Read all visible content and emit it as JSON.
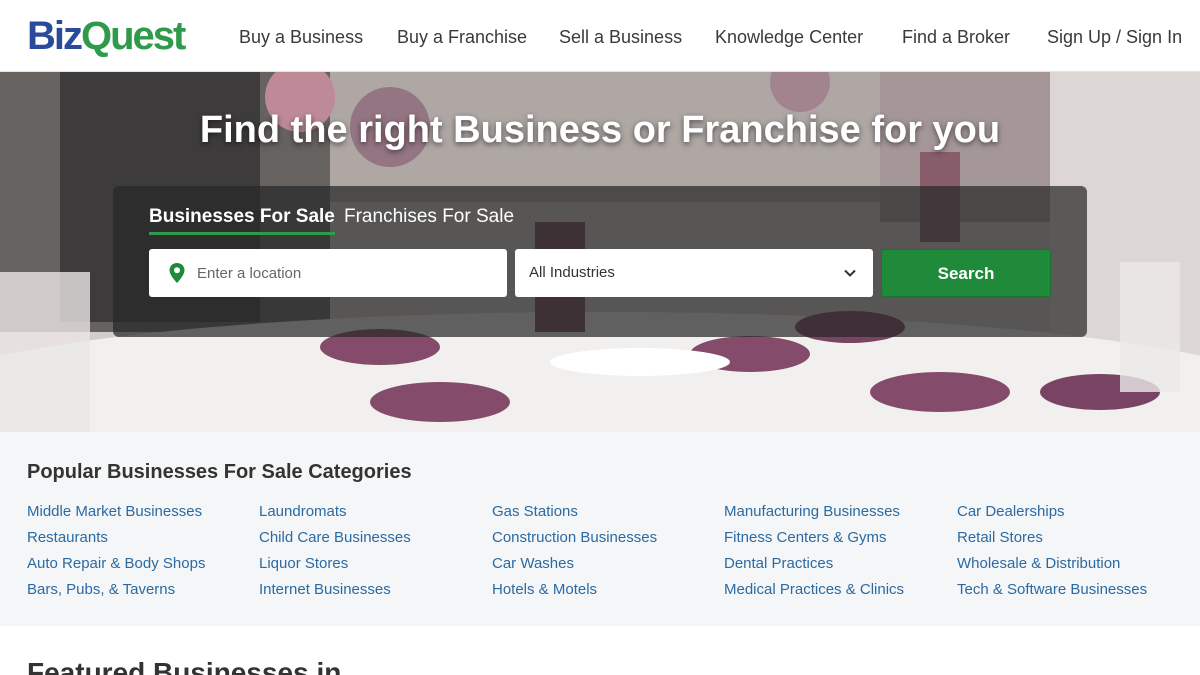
{
  "header": {
    "logo": {
      "part1": "Biz",
      "part2": "Quest"
    },
    "nav": [
      {
        "label": "Buy a Business"
      },
      {
        "label": "Buy a Franchise"
      },
      {
        "label": "Sell a Business"
      },
      {
        "label": "Knowledge Center"
      },
      {
        "label": "Find a Broker"
      },
      {
        "label": "Sign Up / Sign In"
      }
    ]
  },
  "hero": {
    "title": "Find the right Business or Franchise for you",
    "tabs": [
      {
        "label": "Businesses For Sale",
        "active": true
      },
      {
        "label": "Franchises For Sale",
        "active": false
      }
    ],
    "location_placeholder": "Enter a location",
    "industry_selected": "All Industries",
    "search_label": "Search"
  },
  "categories": {
    "title": "Popular Businesses For Sale Categories",
    "columns": [
      [
        "Middle Market Businesses",
        "Restaurants",
        "Auto Repair & Body Shops",
        "Bars, Pubs, & Taverns"
      ],
      [
        "Laundromats",
        "Child Care Businesses",
        "Liquor Stores",
        "Internet Businesses"
      ],
      [
        "Gas Stations",
        "Construction Businesses",
        "Car Washes",
        "Hotels & Motels"
      ],
      [
        "Manufacturing Businesses",
        "Fitness Centers & Gyms",
        "Dental Practices",
        "Medical Practices & Clinics"
      ],
      [
        "Car Dealerships",
        "Retail Stores",
        "Wholesale & Distribution",
        "Tech & Software Businesses"
      ]
    ]
  },
  "featured_title": "Featured Businesses in",
  "colors": {
    "brand_blue": "#2a4a9c",
    "brand_green": "#2f9a4a",
    "button_green": "#1f8a3a",
    "link_blue": "#2b6aa3"
  },
  "icons": {
    "location": "map-pin-icon",
    "dropdown": "chevron-down-icon"
  }
}
